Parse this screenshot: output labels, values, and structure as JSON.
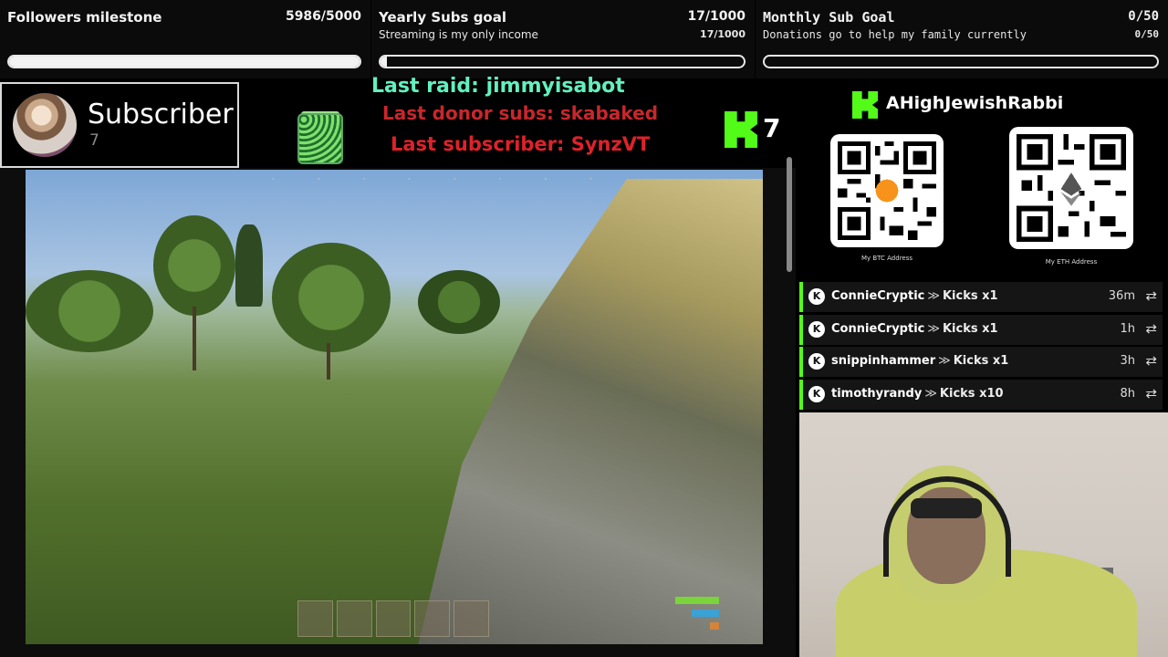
{
  "goals": {
    "followers": {
      "title": "Followers milestone",
      "count": "5986/5000",
      "progress": 1.0
    },
    "yearly": {
      "title": "Yearly Subs goal",
      "count": "17/1000",
      "subtitle": "Streaming is my only income",
      "sub_count": "17/1000",
      "progress": 0.017
    },
    "monthly": {
      "title": "Monthly Sub Goal",
      "count": "0/50",
      "subtitle": "Donations go to help my family currently",
      "sub_count": "0/50",
      "progress": 0.0
    }
  },
  "subscriber_badge": {
    "label": "Subscriber",
    "count": "7"
  },
  "events": {
    "last_raid": "Last raid: jimmyisabot",
    "last_donor_subs": "Last donor subs: skabaked",
    "last_subscriber": "Last subscriber: SynzVT"
  },
  "kick_counter": {
    "value": "7"
  },
  "streamer": {
    "name": "AHighJewishRabbi"
  },
  "qr_codes": [
    {
      "caption": "My BTC Address",
      "icon": "bitcoin-icon"
    },
    {
      "caption": "My ETH Address",
      "icon": "ethereum-icon"
    }
  ],
  "kicks": [
    {
      "user": "ConnieCryptic",
      "amount": "Kicks x1",
      "time": "36m"
    },
    {
      "user": "ConnieCryptic",
      "amount": "Kicks x1",
      "time": "1h"
    },
    {
      "user": "snippinhammer",
      "amount": "Kicks x1",
      "time": "3h"
    },
    {
      "user": "timothyrandy",
      "amount": "Kicks x10",
      "time": "8h"
    }
  ],
  "colors": {
    "kick_green": "#53fc18",
    "raid": "#62f0c0",
    "donor": "#c9262c"
  }
}
